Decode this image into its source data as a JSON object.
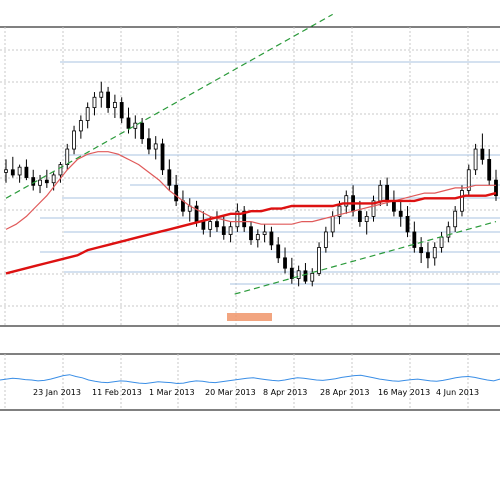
{
  "colors": {
    "background": "#ffffff",
    "frame": "#000000",
    "grid": "#c8c8c8",
    "candle": "#000000",
    "ema_fast": "#e05a5a",
    "ema_slow": "#dd1111",
    "trendline": "#2a9a3a",
    "horizontal_levels": "#a9c3e0",
    "oscillator": "#3a8ee6",
    "highlight_box": "#f0956a"
  },
  "chart_data": [
    {
      "type": "candlestick",
      "panel": "price",
      "title": "",
      "x_tick_labels": [
        "23 Jan 2013",
        "11 Feb 2013",
        "1 Mar 2013",
        "20 Mar 2013",
        "8 Apr 2013",
        "28 Apr 2013",
        "16 May 2013",
        "4 Jun 2013"
      ],
      "y_range": [
        0,
        100
      ],
      "grid": true,
      "candles": [
        {
          "o": 57,
          "h": 62,
          "l": 53,
          "c": 58
        },
        {
          "o": 58,
          "h": 63,
          "l": 55,
          "c": 56
        },
        {
          "o": 56,
          "h": 60,
          "l": 53,
          "c": 59
        },
        {
          "o": 59,
          "h": 62,
          "l": 54,
          "c": 55
        },
        {
          "o": 55,
          "h": 58,
          "l": 50,
          "c": 52
        },
        {
          "o": 52,
          "h": 56,
          "l": 49,
          "c": 54
        },
        {
          "o": 54,
          "h": 58,
          "l": 51,
          "c": 53
        },
        {
          "o": 53,
          "h": 57,
          "l": 50,
          "c": 56
        },
        {
          "o": 56,
          "h": 61,
          "l": 53,
          "c": 60
        },
        {
          "o": 60,
          "h": 68,
          "l": 58,
          "c": 66
        },
        {
          "o": 66,
          "h": 75,
          "l": 64,
          "c": 73
        },
        {
          "o": 73,
          "h": 79,
          "l": 70,
          "c": 77
        },
        {
          "o": 77,
          "h": 84,
          "l": 74,
          "c": 82
        },
        {
          "o": 82,
          "h": 88,
          "l": 79,
          "c": 86
        },
        {
          "o": 86,
          "h": 92,
          "l": 82,
          "c": 88
        },
        {
          "o": 88,
          "h": 90,
          "l": 80,
          "c": 82
        },
        {
          "o": 82,
          "h": 87,
          "l": 78,
          "c": 84
        },
        {
          "o": 84,
          "h": 86,
          "l": 76,
          "c": 78
        },
        {
          "o": 78,
          "h": 82,
          "l": 72,
          "c": 74
        },
        {
          "o": 74,
          "h": 79,
          "l": 70,
          "c": 76
        },
        {
          "o": 76,
          "h": 78,
          "l": 68,
          "c": 70
        },
        {
          "o": 70,
          "h": 74,
          "l": 64,
          "c": 66
        },
        {
          "o": 66,
          "h": 71,
          "l": 62,
          "c": 68
        },
        {
          "o": 68,
          "h": 70,
          "l": 56,
          "c": 58
        },
        {
          "o": 58,
          "h": 62,
          "l": 50,
          "c": 52
        },
        {
          "o": 52,
          "h": 56,
          "l": 44,
          "c": 46
        },
        {
          "o": 46,
          "h": 50,
          "l": 40,
          "c": 42
        },
        {
          "o": 42,
          "h": 47,
          "l": 38,
          "c": 44
        },
        {
          "o": 44,
          "h": 46,
          "l": 36,
          "c": 38
        },
        {
          "o": 38,
          "h": 42,
          "l": 33,
          "c": 35
        },
        {
          "o": 35,
          "h": 40,
          "l": 32,
          "c": 38
        },
        {
          "o": 38,
          "h": 42,
          "l": 34,
          "c": 36
        },
        {
          "o": 36,
          "h": 40,
          "l": 31,
          "c": 33
        },
        {
          "o": 33,
          "h": 38,
          "l": 30,
          "c": 36
        },
        {
          "o": 36,
          "h": 45,
          "l": 34,
          "c": 42
        },
        {
          "o": 42,
          "h": 44,
          "l": 34,
          "c": 36
        },
        {
          "o": 36,
          "h": 38,
          "l": 29,
          "c": 31
        },
        {
          "o": 31,
          "h": 35,
          "l": 28,
          "c": 33
        },
        {
          "o": 33,
          "h": 37,
          "l": 30,
          "c": 34
        },
        {
          "o": 34,
          "h": 36,
          "l": 27,
          "c": 29
        },
        {
          "o": 29,
          "h": 32,
          "l": 22,
          "c": 24
        },
        {
          "o": 24,
          "h": 28,
          "l": 18,
          "c": 20
        },
        {
          "o": 20,
          "h": 24,
          "l": 14,
          "c": 16
        },
        {
          "o": 16,
          "h": 21,
          "l": 13,
          "c": 19
        },
        {
          "o": 19,
          "h": 22,
          "l": 14,
          "c": 15
        },
        {
          "o": 15,
          "h": 20,
          "l": 13,
          "c": 18
        },
        {
          "o": 18,
          "h": 30,
          "l": 17,
          "c": 28
        },
        {
          "o": 28,
          "h": 36,
          "l": 26,
          "c": 34
        },
        {
          "o": 34,
          "h": 42,
          "l": 32,
          "c": 40
        },
        {
          "o": 40,
          "h": 46,
          "l": 37,
          "c": 44
        },
        {
          "o": 44,
          "h": 50,
          "l": 41,
          "c": 48
        },
        {
          "o": 48,
          "h": 52,
          "l": 40,
          "c": 42
        },
        {
          "o": 42,
          "h": 46,
          "l": 36,
          "c": 38
        },
        {
          "o": 38,
          "h": 42,
          "l": 33,
          "c": 40
        },
        {
          "o": 40,
          "h": 48,
          "l": 38,
          "c": 46
        },
        {
          "o": 46,
          "h": 54,
          "l": 44,
          "c": 52
        },
        {
          "o": 52,
          "h": 55,
          "l": 44,
          "c": 46
        },
        {
          "o": 46,
          "h": 50,
          "l": 40,
          "c": 42
        },
        {
          "o": 42,
          "h": 46,
          "l": 36,
          "c": 40
        },
        {
          "o": 40,
          "h": 44,
          "l": 32,
          "c": 34
        },
        {
          "o": 34,
          "h": 38,
          "l": 26,
          "c": 28
        },
        {
          "o": 28,
          "h": 32,
          "l": 22,
          "c": 26
        },
        {
          "o": 26,
          "h": 30,
          "l": 20,
          "c": 24
        },
        {
          "o": 24,
          "h": 30,
          "l": 21,
          "c": 28
        },
        {
          "o": 28,
          "h": 34,
          "l": 26,
          "c": 32
        },
        {
          "o": 32,
          "h": 38,
          "l": 30,
          "c": 36
        },
        {
          "o": 36,
          "h": 44,
          "l": 34,
          "c": 42
        },
        {
          "o": 42,
          "h": 52,
          "l": 40,
          "c": 50
        },
        {
          "o": 50,
          "h": 60,
          "l": 48,
          "c": 58
        },
        {
          "o": 58,
          "h": 68,
          "l": 56,
          "c": 66
        },
        {
          "o": 66,
          "h": 72,
          "l": 60,
          "c": 62
        },
        {
          "o": 62,
          "h": 66,
          "l": 52,
          "c": 54
        },
        {
          "o": 54,
          "h": 58,
          "l": 46,
          "c": 48
        }
      ],
      "lines": [
        {
          "style": "ema",
          "points": [
            35,
            37,
            40,
            44,
            48,
            53,
            58,
            62,
            64,
            65,
            65,
            64,
            62,
            60,
            57,
            54,
            50,
            47,
            44,
            42,
            40,
            39,
            38,
            38,
            38,
            37,
            37,
            37,
            37,
            38,
            38,
            39,
            40,
            41,
            42,
            43,
            44,
            45,
            46,
            47,
            48,
            49,
            49,
            50,
            51,
            51,
            52,
            52,
            52
          ]
        },
        {
          "style": "sma",
          "points": [
            18,
            19,
            20,
            21,
            22,
            23,
            24,
            25,
            27,
            28,
            29,
            30,
            31,
            32,
            33,
            34,
            35,
            36,
            37,
            38,
            39,
            40,
            41,
            41,
            42,
            42,
            43,
            43,
            44,
            44,
            44,
            44,
            44,
            45,
            45,
            45,
            45,
            46,
            46,
            46,
            46,
            47,
            47,
            47,
            47,
            48,
            48,
            48,
            49
          ]
        }
      ],
      "trendlines": [
        {
          "from": [
            0,
            47
          ],
          "to": [
            100,
            118
          ]
        },
        {
          "from": [
            70,
            10
          ],
          "to": [
            150,
            38
          ]
        }
      ]
    },
    {
      "type": "line",
      "panel": "oscillator",
      "y_range": [
        0,
        100
      ],
      "values": [
        50,
        52,
        54,
        53,
        51,
        50,
        48,
        49,
        52,
        56,
        60,
        62,
        58,
        55,
        50,
        47,
        45,
        44,
        46,
        48,
        47,
        45,
        43,
        42,
        44,
        46,
        45,
        44,
        42,
        43,
        46,
        48,
        47,
        45,
        44,
        46,
        48,
        50,
        52,
        54,
        55,
        53,
        51,
        49,
        48,
        50,
        53,
        55,
        54,
        52,
        50,
        49,
        51,
        53,
        56,
        58,
        60,
        61,
        58,
        55,
        52,
        50,
        48,
        47,
        49,
        51,
        52,
        50,
        48,
        47,
        49,
        52,
        55,
        57,
        58,
        56,
        53,
        50,
        48,
        52
      ]
    }
  ]
}
